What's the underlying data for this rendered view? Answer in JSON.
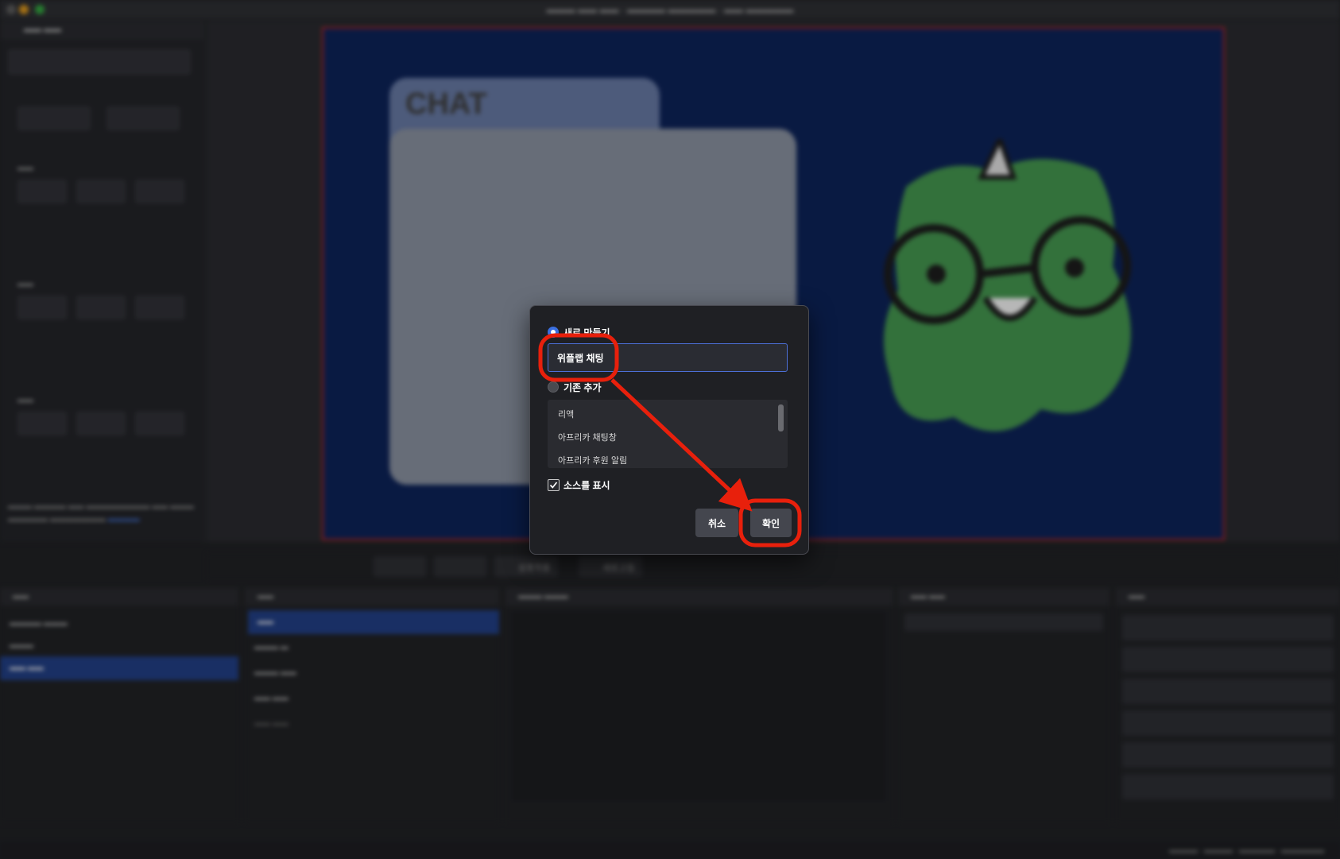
{
  "dialog": {
    "option_new_label": "새로 만들기",
    "name_value": "위플랩 채팅",
    "option_existing_label": "기존 추가",
    "existing_sources": [
      "리액",
      "아프리카 채팅창",
      "아프리카 후원 알림"
    ],
    "show_source_label": "소스를 표시",
    "cancel_label": "취소",
    "ok_label": "확인"
  },
  "preview": {
    "chat_title": "CHAT"
  },
  "toolbar": {
    "interact_label": "상호작용",
    "refresh_label": "새로고침"
  },
  "colors": {
    "accent": "#3a6fe0",
    "annotation": "#e8200c",
    "preview_bg": "#0c2051",
    "mascot": "#3f8a49",
    "selection": "#1f3a7a"
  }
}
